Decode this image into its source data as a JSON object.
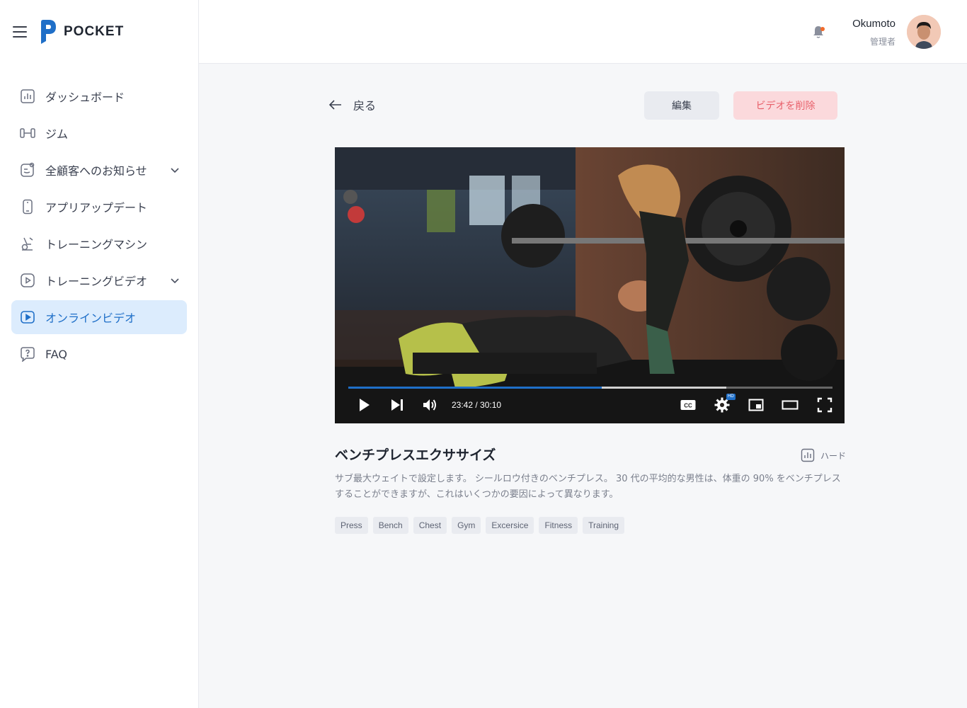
{
  "brand": {
    "name": "POCKET",
    "color": "#1f6fc8"
  },
  "sidebar": {
    "items": [
      {
        "label": "ダッシュボード",
        "icon": "chart-icon",
        "active": false,
        "expandable": false
      },
      {
        "label": "ジム",
        "icon": "gym-icon",
        "active": false,
        "expandable": false
      },
      {
        "label": "全顧客へのお知らせ",
        "icon": "announcement-icon",
        "active": false,
        "expandable": true
      },
      {
        "label": "アプリアップデート",
        "icon": "phone-icon",
        "active": false,
        "expandable": false
      },
      {
        "label": "トレーニングマシン",
        "icon": "machine-icon",
        "active": false,
        "expandable": false
      },
      {
        "label": "トレーニングビデオ",
        "icon": "video-icon",
        "active": false,
        "expandable": true
      },
      {
        "label": "オンラインビデオ",
        "icon": "video-icon",
        "active": true,
        "expandable": false
      },
      {
        "label": "FAQ",
        "icon": "faq-icon",
        "active": false,
        "expandable": false
      }
    ]
  },
  "header": {
    "user_name": "Okumoto",
    "user_role": "管理者",
    "notification_dot_color": "#f26b2b"
  },
  "actions": {
    "back_label": "戻る",
    "edit_label": "編集",
    "delete_label": "ビデオを削除"
  },
  "player": {
    "current_time": "23:42",
    "duration": "30:10",
    "time_display": "23:42 / 30:10",
    "progress_fraction": 0.524,
    "buffered_fraction": 0.78,
    "quality_badge": "HD",
    "cc_label": "CC"
  },
  "video": {
    "title": "ベンチプレスエクササイズ",
    "difficulty": "ハード",
    "description": "サブ最大ウェイトで設定します。 シールロウ付きのベンチプレス。 30 代の平均的な男性は、体重の 90% をベンチプレスすることができますが、これはいくつかの要因によって異なります。",
    "tags": [
      "Press",
      "Bench",
      "Chest",
      "Gym",
      "Excersice",
      "Fitness",
      "Training"
    ]
  }
}
